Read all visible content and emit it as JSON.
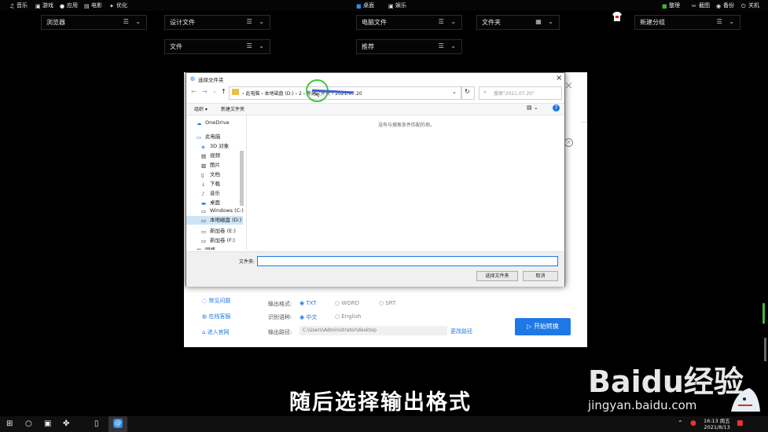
{
  "topbar": {
    "left": [
      "音乐",
      "游戏",
      "应用",
      "电影",
      "优化"
    ],
    "center": [
      "桌面",
      "娱乐"
    ],
    "right": [
      "整理",
      "截图",
      "备份",
      "关机"
    ]
  },
  "desktop_groups": [
    "浏览器",
    "设计文件",
    "电脑文件",
    "文件夹",
    "新建分组",
    "文件",
    "推荐"
  ],
  "dialog": {
    "title": "选择文件夹",
    "path": [
      "此电脑",
      "本地磁盘 (D:)",
      "2",
      "新建文件夹",
      "2021.07.20"
    ],
    "search_placeholder": "搜索\"2021.07.20\"",
    "toolbar": {
      "organize": "组织 ▾",
      "new_folder": "新建文件夹"
    },
    "empty_message": "没有与搜索条件匹配的项。",
    "sidebar": [
      "OneDrive",
      "此电脑",
      "3D 对象",
      "视频",
      "图片",
      "文档",
      "下载",
      "音乐",
      "桌面",
      "Windows (C:)",
      "本地磁盘 (D:)",
      "新加卷 (E:)",
      "新加卷 (F:)",
      "网络"
    ],
    "folder_label": "文件夹:",
    "folder_value": "",
    "select_button": "选择文件夹",
    "cancel_button": "取消"
  },
  "app": {
    "side_links": [
      "常见问题",
      "在线客服",
      "进入官网"
    ],
    "output_format_label": "输出格式:",
    "formats": [
      "TXT",
      "WORD",
      "SRT"
    ],
    "lang_label": "识别语种:",
    "langs": [
      "中文",
      "English"
    ],
    "path_label": "输出路径:",
    "path_value": "C:\\Users\\Administrator\\desktop",
    "change_path": "更改路径",
    "start_button": "开始转换"
  },
  "subtitle": "随后选择输出格式",
  "watermark": {
    "brand": "Baidu经验",
    "url": "jingyan.baidu.com"
  },
  "taskbar": {
    "time": "16:13 周五",
    "date": "2021/8/13"
  },
  "colors": {
    "accent": "#1e78e6",
    "highlight_circle": "#3cc83c"
  }
}
